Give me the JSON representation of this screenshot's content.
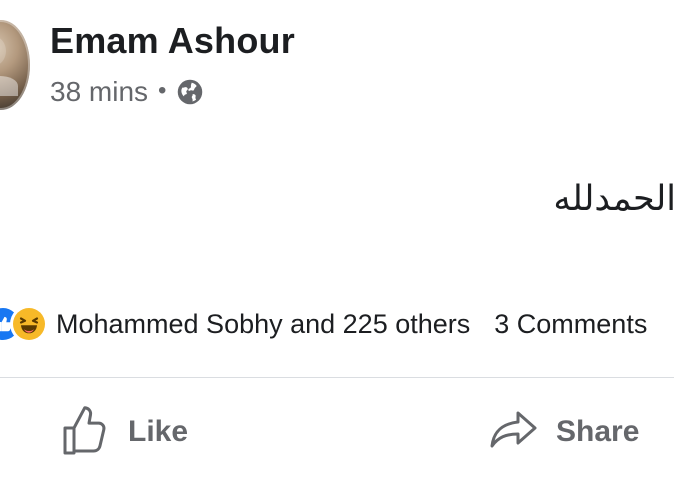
{
  "post": {
    "author": {
      "name": "Emam Ashour"
    },
    "meta": {
      "time": "38 mins",
      "separator": "•",
      "visibility_icon": "globe-icon"
    },
    "content": {
      "text": "الحمدلله"
    },
    "reactions": {
      "icons": [
        "like-icon",
        "haha-icon"
      ],
      "summary": "Mohammed Sobhy and 225 others",
      "comments": "3 Comments"
    },
    "actions": {
      "like": "Like",
      "share": "Share"
    }
  },
  "colors": {
    "text_primary": "#1c1e21",
    "text_secondary": "#65676b",
    "divider": "#dadde1",
    "like_blue": "#1877f2",
    "haha_yellow": "#f7b928"
  }
}
